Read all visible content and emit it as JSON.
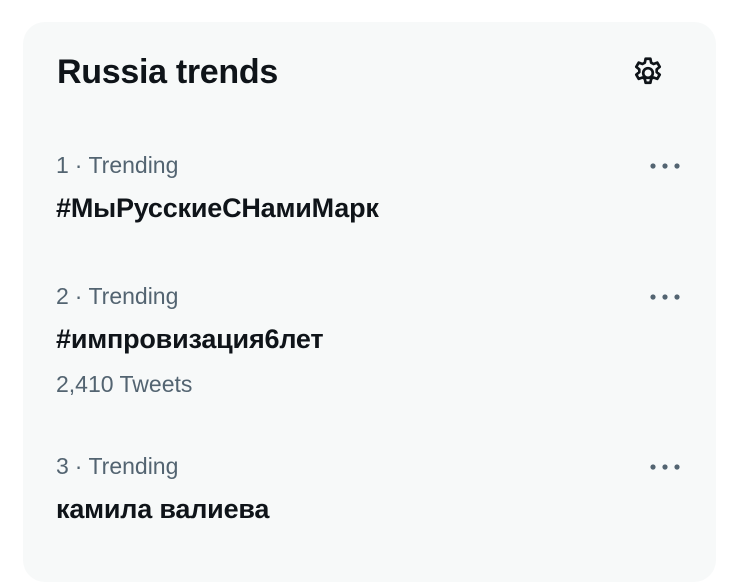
{
  "header": {
    "title": "Russia trends",
    "settings_icon": "gear-icon"
  },
  "trends": [
    {
      "rank": "1",
      "separator": "·",
      "label": "Trending",
      "name": "#МыРусскиеСНамиМарк",
      "count": ""
    },
    {
      "rank": "2",
      "separator": "·",
      "label": "Trending",
      "name": "#импровизация6лет",
      "count": "2,410 Tweets"
    },
    {
      "rank": "3",
      "separator": "·",
      "label": "Trending",
      "name": "камила валиева",
      "count": ""
    }
  ],
  "colors": {
    "panel_bg": "#f7f9f9",
    "primary_text": "#0f1419",
    "secondary_text": "#536471"
  }
}
